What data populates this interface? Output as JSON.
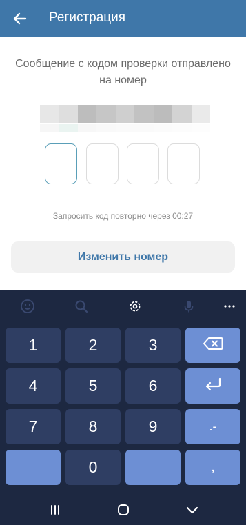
{
  "app": {
    "title": "Регистрация",
    "accent_color": "#3f77a9",
    "back_icon": "arrow-left-icon"
  },
  "verification": {
    "message": "Сообщение с кодом проверки отправлено на номер",
    "phone_number_blurred": true,
    "code_length": 4,
    "code_digits": [
      "",
      "",
      "",
      ""
    ],
    "resend_text": "Запросить код повторно через 00:27",
    "change_number_label": "Изменить номер"
  },
  "keyboard": {
    "background": "#1d2841",
    "toolbar": [
      "emoji-icon",
      "search-icon",
      "settings-gear-icon",
      "microphone-icon",
      "more-dots-icon"
    ],
    "keys": {
      "k1": "1",
      "k2": "2",
      "k3": "3",
      "k4": "4",
      "k5": "5",
      "k6": "6",
      "k7": "7",
      "k8": "8",
      "k9": "9",
      "k0": "0",
      "dotdash": ".-",
      "comma": ","
    },
    "special_keys": [
      "backspace-icon",
      "enter-icon"
    ]
  },
  "navigation": [
    "recent-apps-icon",
    "home-icon",
    "back-chevron-icon"
  ]
}
